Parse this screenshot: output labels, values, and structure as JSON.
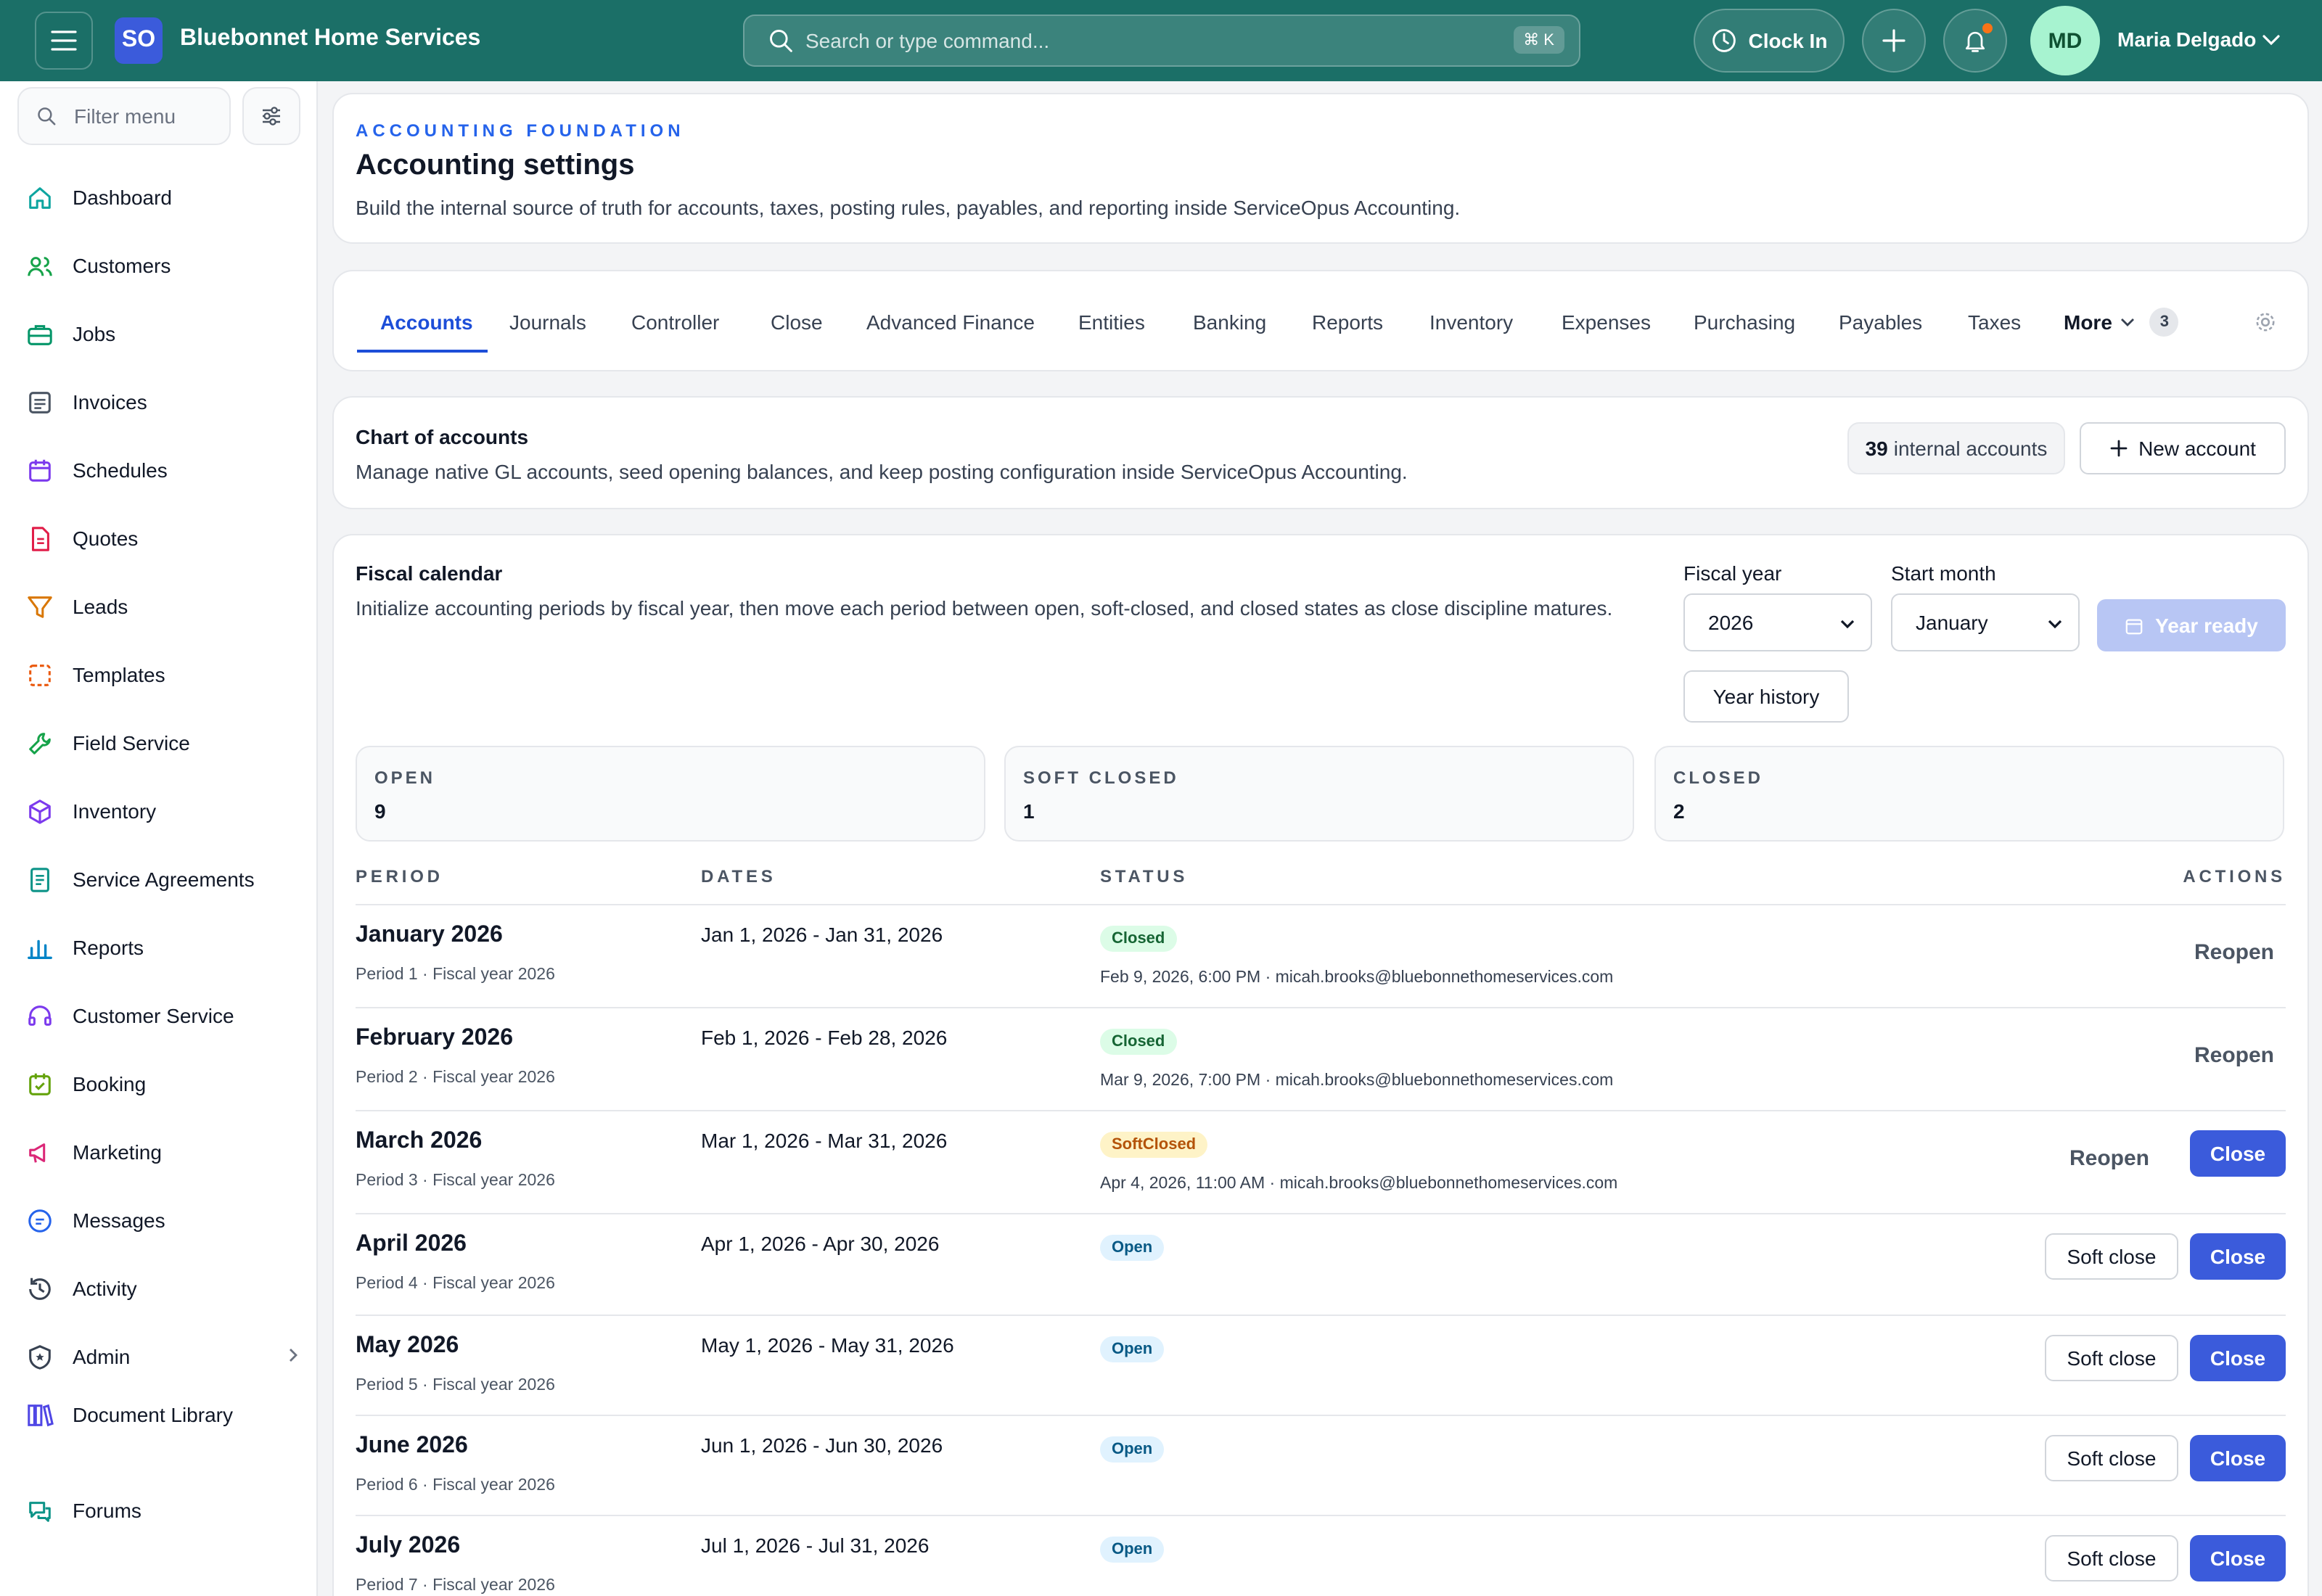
{
  "topbar": {
    "logo": "SO",
    "brand": "Bluebonnet Home Services",
    "search_placeholder": "Search or type command...",
    "shortcut": "⌘ K",
    "clock_in": "Clock In",
    "avatar_initials": "MD",
    "user_name": "Maria Delgado"
  },
  "sidebar": {
    "filter_placeholder": "Filter menu",
    "items": [
      {
        "label": "Dashboard",
        "icon": "home-icon",
        "color": "#0ea5a0"
      },
      {
        "label": "Customers",
        "icon": "users-icon",
        "color": "#16a34a"
      },
      {
        "label": "Jobs",
        "icon": "briefcase-icon",
        "color": "#059669"
      },
      {
        "label": "Invoices",
        "icon": "invoice-icon",
        "color": "#4b5563"
      },
      {
        "label": "Schedules",
        "icon": "calendar-icon",
        "color": "#7c3aed"
      },
      {
        "label": "Quotes",
        "icon": "document-icon",
        "color": "#e11d48"
      },
      {
        "label": "Leads",
        "icon": "filter-icon",
        "color": "#d97706"
      },
      {
        "label": "Templates",
        "icon": "template-icon",
        "color": "#ea580c"
      },
      {
        "label": "Field Service",
        "icon": "wrench-icon",
        "color": "#16a34a"
      },
      {
        "label": "Inventory",
        "icon": "box-icon",
        "color": "#7c3aed"
      },
      {
        "label": "Service Agreements",
        "icon": "agreement-icon",
        "color": "#0d9488"
      },
      {
        "label": "Reports",
        "icon": "bar-chart-icon",
        "color": "#0284c7"
      },
      {
        "label": "Customer Service",
        "icon": "headset-icon",
        "color": "#7c3aed"
      },
      {
        "label": "Booking",
        "icon": "calendar-check-icon",
        "color": "#65a30d"
      },
      {
        "label": "Marketing",
        "icon": "megaphone-icon",
        "color": "#db2777"
      },
      {
        "label": "Messages",
        "icon": "chat-icon",
        "color": "#2563eb"
      },
      {
        "label": "Activity",
        "icon": "history-icon",
        "color": "#374151"
      },
      {
        "label": "Admin",
        "icon": "shield-icon",
        "color": "#374151"
      },
      {
        "label": "Document Library",
        "icon": "library-icon",
        "color": "#4f46e5"
      },
      {
        "label": "Forums",
        "icon": "forum-icon",
        "color": "#0d9488"
      }
    ]
  },
  "header": {
    "eyebrow": "ACCOUNTING FOUNDATION",
    "title": "Accounting settings",
    "description": "Build the internal source of truth for accounts, taxes, posting rules, payables, and reporting inside ServiceOpus Accounting."
  },
  "tabs": {
    "items": [
      "Accounts",
      "Journals",
      "Controller",
      "Close",
      "Advanced Finance",
      "Entities",
      "Banking",
      "Reports",
      "Inventory",
      "Expenses",
      "Purchasing",
      "Payables",
      "Taxes"
    ],
    "active": "Accounts",
    "more_label": "More",
    "more_count": "3"
  },
  "chart_of_accounts": {
    "title": "Chart of accounts",
    "description": "Manage native GL accounts, seed opening balances, and keep posting configuration inside ServiceOpus Accounting.",
    "count": "39",
    "count_label": "internal accounts",
    "new_button": "New account"
  },
  "fiscal": {
    "title": "Fiscal calendar",
    "description": "Initialize accounting periods by fiscal year, then move each period between open, soft-closed, and closed states as close discipline matures.",
    "fiscal_year_label": "Fiscal year",
    "fiscal_year_value": "2026",
    "start_month_label": "Start month",
    "start_month_value": "January",
    "year_ready": "Year ready",
    "year_history": "Year history",
    "stats": [
      {
        "label": "OPEN",
        "value": "9"
      },
      {
        "label": "SOFT CLOSED",
        "value": "1"
      },
      {
        "label": "CLOSED",
        "value": "2"
      }
    ],
    "columns": {
      "period": "PERIOD",
      "dates": "DATES",
      "status": "STATUS",
      "actions": "ACTIONS"
    },
    "rows": [
      {
        "name": "January 2026",
        "sub": "Period 1 · Fiscal year 2026",
        "dates": "Jan 1, 2026 - Jan 31, 2026",
        "status": "Closed",
        "meta": "Feb 9, 2026, 6:00 PM · micah.brooks@bluebonnethomeservices.com",
        "reopen": "Reopen"
      },
      {
        "name": "February 2026",
        "sub": "Period 2 · Fiscal year 2026",
        "dates": "Feb 1, 2026 - Feb 28, 2026",
        "status": "Closed",
        "meta": "Mar 9, 2026, 7:00 PM · micah.brooks@bluebonnethomeservices.com",
        "reopen": "Reopen"
      },
      {
        "name": "March 2026",
        "sub": "Period 3 · Fiscal year 2026",
        "dates": "Mar 1, 2026 - Mar 31, 2026",
        "status": "SoftClosed",
        "meta": "Apr 4, 2026, 11:00 AM · micah.brooks@bluebonnethomeservices.com",
        "reopen": "Reopen",
        "close": "Close"
      },
      {
        "name": "April 2026",
        "sub": "Period 4 · Fiscal year 2026",
        "dates": "Apr 1, 2026 - Apr 30, 2026",
        "status": "Open",
        "soft_close": "Soft close",
        "close": "Close"
      },
      {
        "name": "May 2026",
        "sub": "Period 5 · Fiscal year 2026",
        "dates": "May 1, 2026 - May 31, 2026",
        "status": "Open",
        "soft_close": "Soft close",
        "close": "Close"
      },
      {
        "name": "June 2026",
        "sub": "Period 6 · Fiscal year 2026",
        "dates": "Jun 1, 2026 - Jun 30, 2026",
        "status": "Open",
        "soft_close": "Soft close",
        "close": "Close"
      },
      {
        "name": "July 2026",
        "sub": "Period 7 · Fiscal year 2026",
        "dates": "Jul 1, 2026 - Jul 31, 2026",
        "status": "Open",
        "soft_close": "Soft close",
        "close": "Close"
      }
    ]
  },
  "colors": {
    "topbar": "#1b6f67",
    "primary": "#3b5bdb",
    "accent": "#1d4ed8"
  }
}
